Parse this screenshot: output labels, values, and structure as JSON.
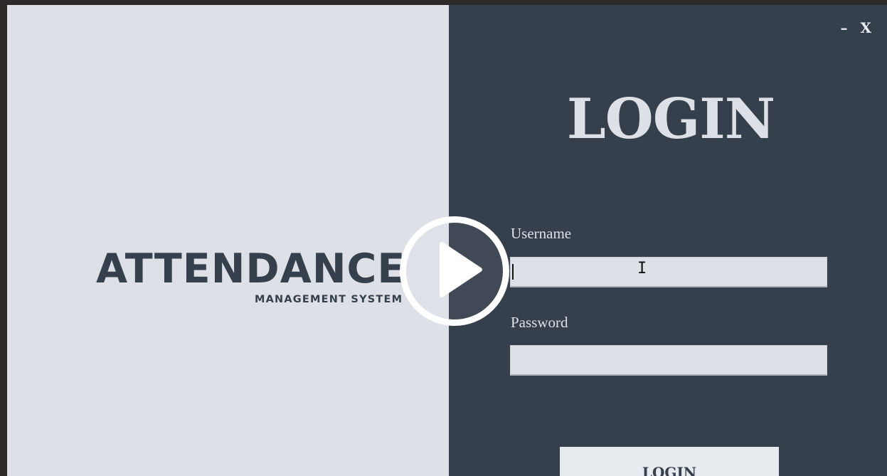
{
  "brand": {
    "title": "ATTENDANCE",
    "subtitle": "MANAGEMENT SYSTEM"
  },
  "window_controls": {
    "minimize": "–",
    "close": "X"
  },
  "login": {
    "title": "LOGIN",
    "username_label": "Username",
    "username_value": "",
    "password_label": "Password",
    "password_value": "",
    "button_label": "LOGIN"
  },
  "overlay": {
    "icon": "play-icon"
  },
  "colors": {
    "left_panel": "#dde1e7",
    "right_panel": "#36404c",
    "text_dark": "#36404c",
    "text_light": "#dde1e7"
  }
}
